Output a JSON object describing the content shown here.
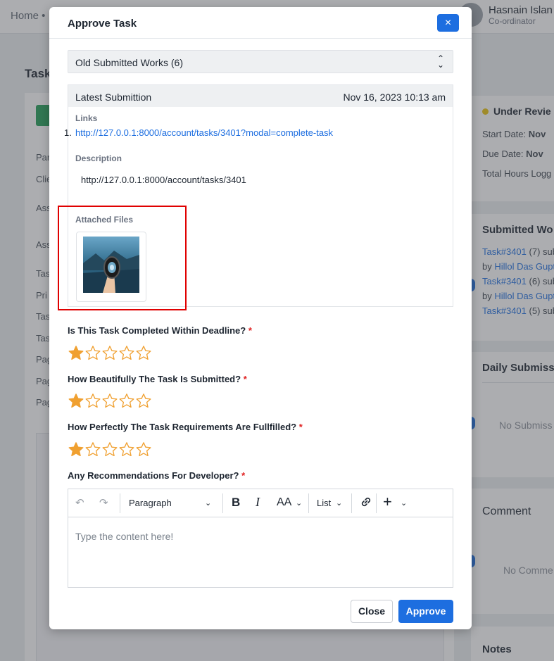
{
  "background": {
    "breadcrumb": "Home •",
    "user_name": "Hasnain Islan",
    "user_role": "Co-ordinator",
    "page_title": "Task",
    "left_labels": [
      "Par",
      "Clie",
      "Ass",
      "Ass",
      "Tas",
      "Pri",
      "Tas",
      "Tas",
      "Pag",
      "Pag",
      "Pag"
    ],
    "status": "Under Revie",
    "start_date_label": "Start Date:",
    "start_date_value": "Nov",
    "due_date_label": "Due Date:",
    "due_date_value": "Nov",
    "total_hours_label": "Total Hours Logg",
    "submitted_heading": "Submitted Wo",
    "submitted_items": [
      {
        "task": "Task#3401",
        "count": "(7) sub",
        "by": "by",
        "author": "Hillol Das Gupt"
      },
      {
        "task": "Task#3401",
        "count": "(6) sub",
        "by": "by",
        "author": "Hillol Das Gupt"
      },
      {
        "task": "Task#3401",
        "count": "(5) sub",
        "by": "",
        "author": ""
      }
    ],
    "daily_heading": "Daily Submiss",
    "daily_empty": "No Submiss",
    "comment_heading": "Comment",
    "comment_empty": "No Comme",
    "notes_heading": "Notes"
  },
  "modal": {
    "title": "Approve Task",
    "close_icon": "×",
    "select_value": "Old Submitted Works (6)",
    "submission": {
      "heading": "Latest Submittion",
      "date": "Nov 16, 2023 10:13 am",
      "links_label": "Links",
      "link_number": "1.",
      "link_url": "http://127.0.0.1:8000/account/tasks/3401?modal=complete-task",
      "description_label": "Description",
      "description": "http://127.0.0.1:8000/account/tasks/3401",
      "files_label": "Attached Files"
    },
    "questions": [
      {
        "text": "Is This Task Completed Within Deadline?",
        "rating": 1,
        "max": 5
      },
      {
        "text": "How Beautifully The Task Is Submitted?",
        "rating": 1,
        "max": 5
      },
      {
        "text": "How Perfectly The Task Requirements Are Fullfilled?",
        "rating": 1,
        "max": 5
      }
    ],
    "required_mark": "*",
    "recommend_label": "Any Recommendations For Developer?",
    "editor": {
      "paragraph": "Paragraph",
      "list": "List",
      "bold": "B",
      "italic": "I",
      "font_size": "AA",
      "placeholder": "Type the content here!"
    },
    "close_button": "Close",
    "approve_button": "Approve"
  },
  "colors": {
    "primary": "#1d6ee0",
    "star": "#f0a030",
    "required": "#e02020",
    "highlight_box": "#e00000"
  }
}
